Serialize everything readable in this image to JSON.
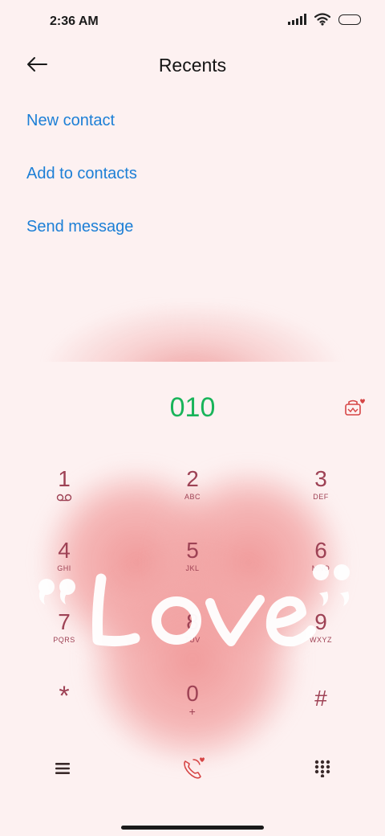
{
  "status_bar": {
    "time": "2:36 AM"
  },
  "header": {
    "title": "Recents"
  },
  "actions": [
    {
      "label": "New contact"
    },
    {
      "label": "Add to contacts"
    },
    {
      "label": "Send message"
    }
  ],
  "dialer": {
    "number": "010"
  },
  "keypad": [
    {
      "digit": "1",
      "letters": ""
    },
    {
      "digit": "2",
      "letters": "ABC"
    },
    {
      "digit": "3",
      "letters": "DEF"
    },
    {
      "digit": "4",
      "letters": "GHI"
    },
    {
      "digit": "5",
      "letters": "JKL"
    },
    {
      "digit": "6",
      "letters": "MNO"
    },
    {
      "digit": "7",
      "letters": "PQRS"
    },
    {
      "digit": "8",
      "letters": "TUV"
    },
    {
      "digit": "9",
      "letters": "WXYZ"
    },
    {
      "digit": "*",
      "letters": ""
    },
    {
      "digit": "0",
      "letters": "+"
    },
    {
      "digit": "#",
      "letters": ""
    }
  ],
  "colors": {
    "background": "#fdf1f1",
    "link": "#1c7fd6",
    "number": "#19b45a",
    "key": "#9e4255",
    "accent": "#d64545"
  },
  "icons": {
    "back": "arrow-left-icon",
    "voicemail": "voicemail-icon",
    "wallpaper": "theme-icon",
    "menu": "menu-icon",
    "call": "phone-call-icon",
    "keypad": "dialpad-icon"
  }
}
